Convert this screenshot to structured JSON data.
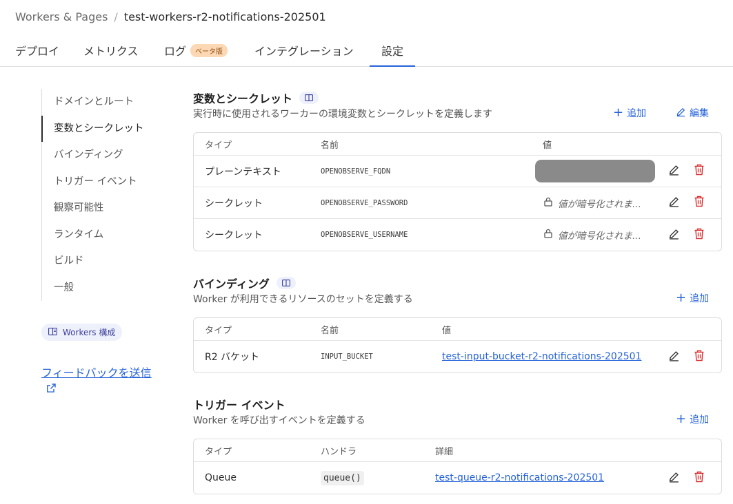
{
  "breadcrumb": {
    "root": "Workers & Pages",
    "separator": "/",
    "current": "test-workers-r2-notifications-202501"
  },
  "tabs": [
    {
      "label": "デプロイ"
    },
    {
      "label": "メトリクス"
    },
    {
      "label": "ログ",
      "badge": "ベータ版"
    },
    {
      "label": "インテグレーション"
    },
    {
      "label": "設定",
      "active": true
    }
  ],
  "sidenav": {
    "items": [
      {
        "label": "ドメインとルート"
      },
      {
        "label": "変数とシークレット",
        "active": true
      },
      {
        "label": "バインディング"
      },
      {
        "label": "トリガー イベント"
      },
      {
        "label": "観察可能性"
      },
      {
        "label": "ランタイム"
      },
      {
        "label": "ビルド"
      },
      {
        "label": "一般"
      }
    ],
    "workers_pill": "Workers 構成",
    "feedback": "フィードバックを送信"
  },
  "variables": {
    "title": "変数とシークレット",
    "description": "実行時に使用されるワーカーの環境変数とシークレットを定義します",
    "add": "追加",
    "edit": "編集",
    "headers": {
      "type": "タイプ",
      "name": "名前",
      "value": "値"
    },
    "rows": [
      {
        "type": "プレーンテキスト",
        "name": "OPENOBSERVE_FQDN",
        "value": ""
      },
      {
        "type": "シークレット",
        "name": "OPENOBSERVE_PASSWORD",
        "value": "値が暗号化されま..."
      },
      {
        "type": "シークレット",
        "name": "OPENOBSERVE_USERNAME",
        "value": "値が暗号化されま..."
      }
    ]
  },
  "bindings": {
    "title": "バインディング",
    "description": "Worker が利用できるリソースのセットを定義する",
    "add": "追加",
    "headers": {
      "type": "タイプ",
      "name": "名前",
      "value": "値"
    },
    "rows": [
      {
        "type": "R2 バケット",
        "name": "INPUT_BUCKET",
        "value": "test-input-bucket-r2-notifications-202501"
      }
    ]
  },
  "triggers": {
    "title": "トリガー イベント",
    "description": "Worker を呼び出すイベントを定義する",
    "add": "追加",
    "headers": {
      "type": "タイプ",
      "handler": "ハンドラ",
      "detail": "詳細"
    },
    "rows": [
      {
        "type": "Queue",
        "handler": "queue()",
        "detail": "test-queue-r2-notifications-202501"
      }
    ]
  },
  "colors": {
    "accent": "#2462d9",
    "danger": "#d93030",
    "badge_bg": "#fcd8b4",
    "pill_bg": "#eef0fb"
  }
}
